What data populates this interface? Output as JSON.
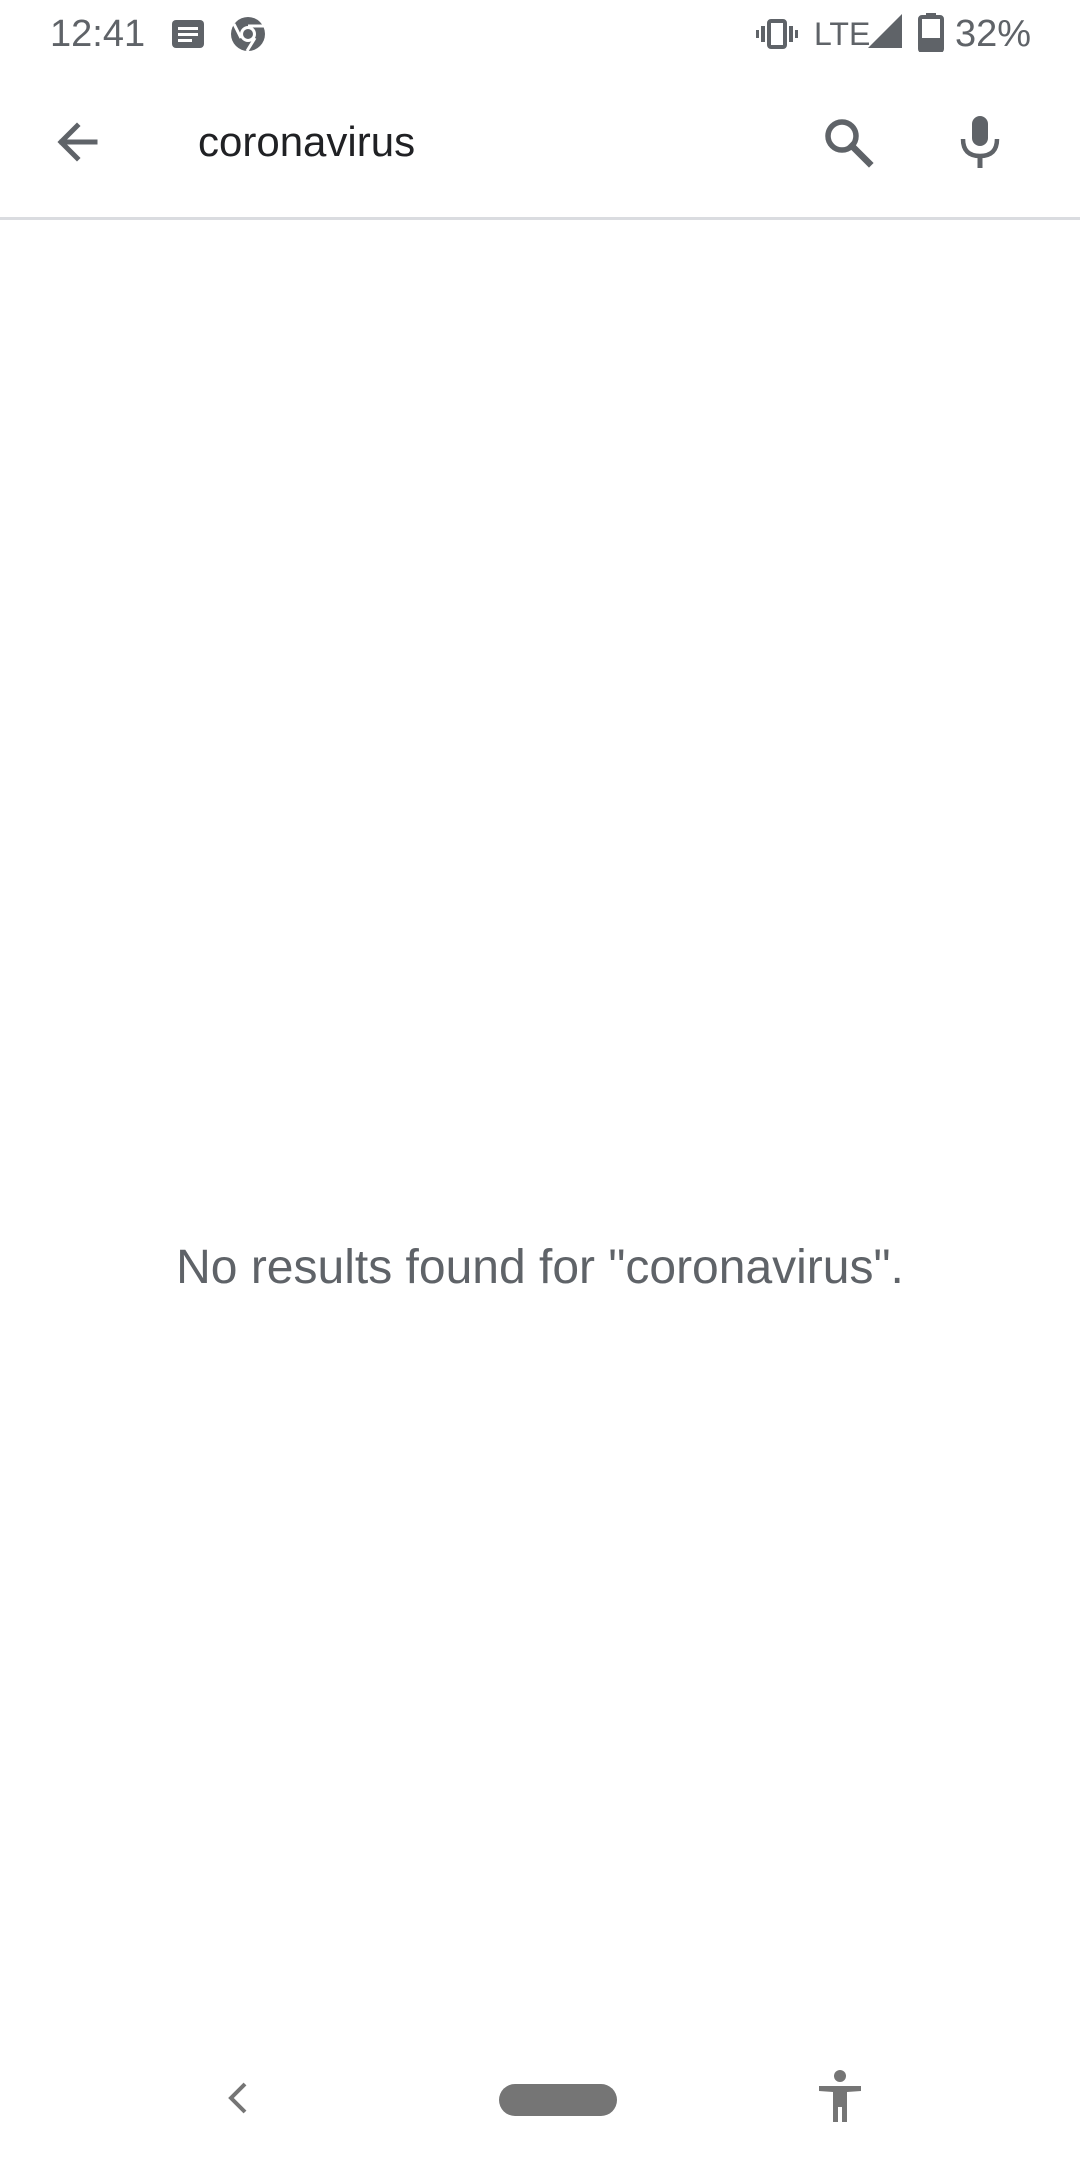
{
  "status_bar": {
    "time": "12:41",
    "network": "LTE",
    "battery_percent": "32%",
    "notification_icons": [
      "message-notification-icon",
      "chrome-icon"
    ],
    "system_icons": [
      "vibrate-icon",
      "signal-icon",
      "battery-icon"
    ]
  },
  "toolbar": {
    "back_icon": "arrow-back-icon",
    "query": "coronavirus",
    "search_icon": "search-icon",
    "mic_icon": "mic-icon"
  },
  "results": {
    "empty_message": "No results found for \"coronavirus\"."
  },
  "nav_bar": {
    "items": [
      "back-chevron-icon",
      "home-pill",
      "accessibility-icon"
    ]
  },
  "colors": {
    "icon_gray": "#5f6368",
    "text_dark": "#202124",
    "divider": "#dadce0",
    "background": "#ffffff"
  }
}
